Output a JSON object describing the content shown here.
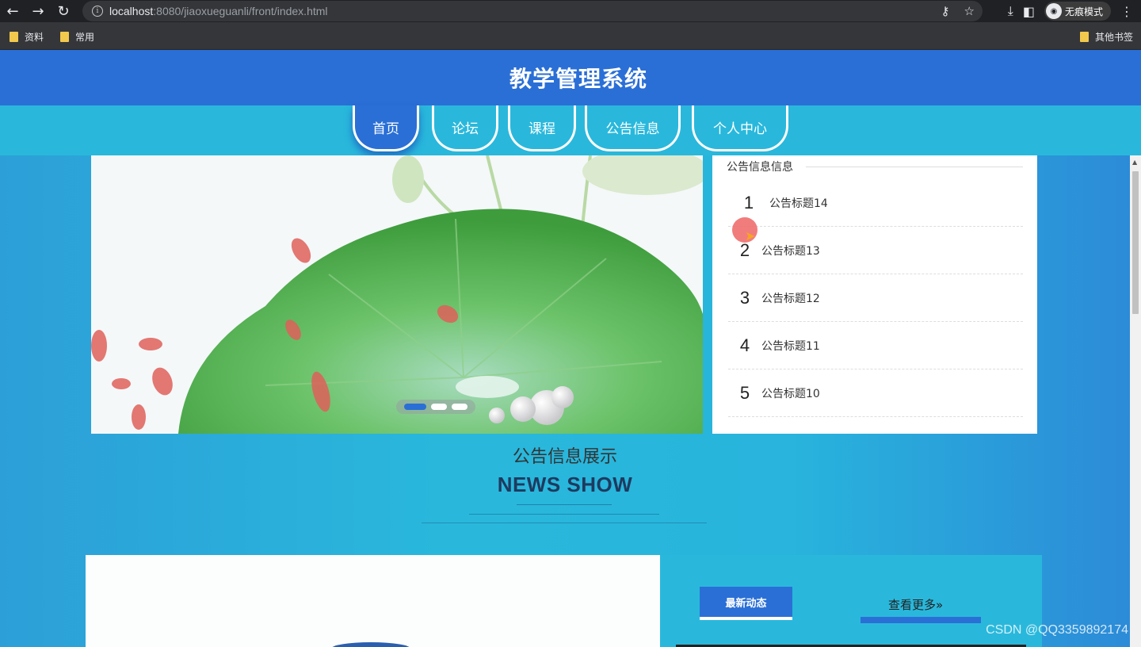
{
  "browser": {
    "url_host": "localhost",
    "url_rest": ":8080/jiaoxueguanli/front/index.html",
    "incognito_label": "无痕模式",
    "bookmarks": [
      "资料",
      "常用"
    ],
    "other_bookmarks": "其他书签"
  },
  "site": {
    "title": "教学管理系统",
    "nav": [
      {
        "label": "首页",
        "active": true
      },
      {
        "label": "论坛",
        "active": false
      },
      {
        "label": "课程",
        "active": false
      },
      {
        "label": "公告信息",
        "active": false
      },
      {
        "label": "个人中心",
        "active": false
      }
    ]
  },
  "notice_panel": {
    "heading": "公告信息信息",
    "items": [
      {
        "num": "1",
        "title": "公告标题14"
      },
      {
        "num": "2",
        "title": "公告标题13"
      },
      {
        "num": "3",
        "title": "公告标题12"
      },
      {
        "num": "4",
        "title": "公告标题11"
      },
      {
        "num": "5",
        "title": "公告标题10"
      }
    ]
  },
  "carousel": {
    "active_index": 0,
    "count": 3
  },
  "section": {
    "title": "公告信息展示",
    "subtitle": "NEWS SHOW"
  },
  "news": {
    "latest_label": "最新动态",
    "more_label": "查看更多"
  },
  "watermark": "CSDN @QQ3359892174",
  "colors": {
    "primary": "#2a6fd6",
    "nav_bg": "#29b8dc"
  }
}
